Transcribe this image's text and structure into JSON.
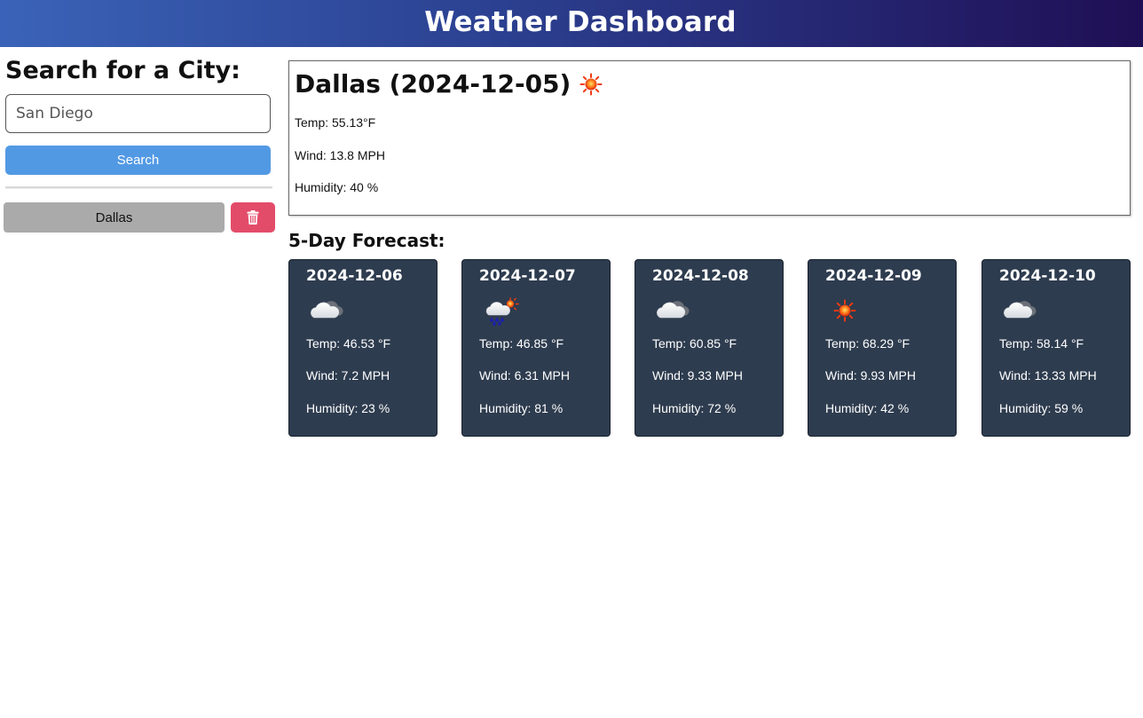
{
  "header": {
    "title": "Weather Dashboard"
  },
  "sidebar": {
    "heading": "Search for a City:",
    "search": {
      "value": "",
      "placeholder": "San Diego"
    },
    "search_button_label": "Search",
    "history": [
      {
        "label": "Dallas"
      }
    ],
    "delete_icon": "trash-icon",
    "colors": {
      "search_button": "#5299e4",
      "history_button": "#aaaaaa",
      "delete_button": "#e34c69"
    }
  },
  "current": {
    "title": "Dallas (2024-12-05)",
    "icon": "sun-icon",
    "temp": "Temp: 55.13°F",
    "wind": "Wind: 13.8 MPH",
    "humidity": "Humidity: 40 %"
  },
  "forecast": {
    "heading": "5-Day Forecast:",
    "card_color": "#2e3c4f",
    "days": [
      {
        "date": "2024-12-06",
        "icon": "cloud-icon",
        "temp": "Temp: 46.53 °F",
        "wind": "Wind: 7.2 MPH",
        "humidity": "Humidity: 23 %"
      },
      {
        "date": "2024-12-07",
        "icon": "rain-sun-icon",
        "temp": "Temp: 46.85 °F",
        "wind": "Wind: 6.31 MPH",
        "humidity": "Humidity: 81 %"
      },
      {
        "date": "2024-12-08",
        "icon": "cloud-icon",
        "temp": "Temp: 60.85 °F",
        "wind": "Wind: 9.33 MPH",
        "humidity": "Humidity: 72 %"
      },
      {
        "date": "2024-12-09",
        "icon": "sun-icon",
        "temp": "Temp: 68.29 °F",
        "wind": "Wind: 9.93 MPH",
        "humidity": "Humidity: 42 %"
      },
      {
        "date": "2024-12-10",
        "icon": "cloud-icon",
        "temp": "Temp: 58.14 °F",
        "wind": "Wind: 13.33 MPH",
        "humidity": "Humidity: 59 %"
      }
    ]
  }
}
